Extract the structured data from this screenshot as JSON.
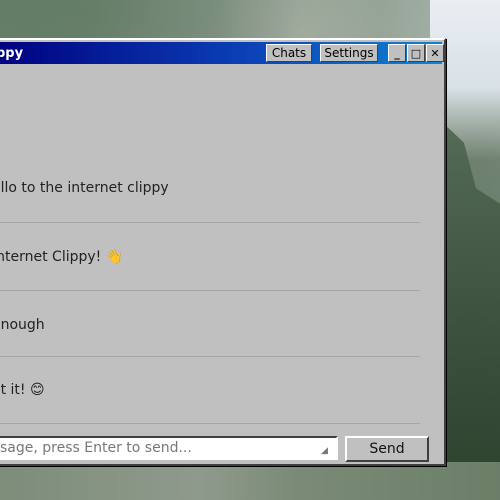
{
  "window": {
    "title": "ppy",
    "buttons": {
      "chats": "Chats",
      "settings": "Settings",
      "minimize": "_",
      "maximize": "□",
      "close": "✕"
    }
  },
  "messages": [
    {
      "text": "ello to the internet clippy"
    },
    {
      "text": "Internet Clippy! 👋"
    },
    {
      "text": "enough"
    },
    {
      "text": "ot it! 😊"
    }
  ],
  "composer": {
    "placeholder": "sage, press Enter to send...",
    "value": "",
    "send_label": "Send"
  }
}
